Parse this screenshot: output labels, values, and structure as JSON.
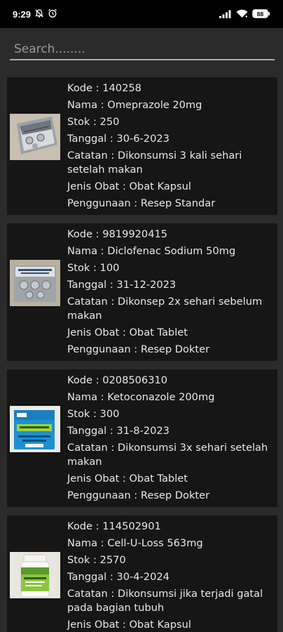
{
  "status": {
    "time": "9:29",
    "battery": "88"
  },
  "search": {
    "placeholder": "Search........"
  },
  "medicines": [
    {
      "kode": "Kode : 140258",
      "nama": "Nama : Omeprazole 20mg",
      "stok": "Stok : 250",
      "tanggal": "Tanggal : 30-6-2023",
      "catatan": "Catatan : Dikonsumsi 3 kali sehari setelah makan",
      "jenis": "Jenis Obat : Obat Kapsul",
      "penggunaan": "Penggunaan : Resep Standar",
      "image": "omeprazole-blister-pack"
    },
    {
      "kode": "Kode : 9819920415",
      "nama": "Nama : Diclofenac Sodium 50mg",
      "stok": "Stok : 100",
      "tanggal": "Tanggal : 31-12-2023",
      "catatan": "Catatan : Dikonsep 2x sehari sebelum makan",
      "jenis": "Jenis Obat : Obat Tablet",
      "penggunaan": "Penggunaan : Resep Dokter",
      "image": "diclofenac-blister-pack"
    },
    {
      "kode": "Kode : 0208506310",
      "nama": "Nama : Ketoconazole 200mg",
      "stok": "Stok : 300",
      "tanggal": "Tanggal : 31-8-2023",
      "catatan": "Catatan : Dikonsumsi 3x sehari setelah makan",
      "jenis": "Jenis Obat : Obat Tablet",
      "penggunaan": "Penggunaan : Resep Dokter",
      "image": "ketoconazole-box"
    },
    {
      "kode": "Kode : 114502901",
      "nama": "Nama : Cell-U-Loss 563mg",
      "stok": "Stok : 2570",
      "tanggal": "Tanggal : 30-4-2024",
      "catatan": "Catatan : Dikonsumsi jika terjadi gatal pada bagian tubuh",
      "jenis": "Jenis Obat : Obat Kapsul",
      "penggunaan": "",
      "image": "cell-u-loss-bottle"
    }
  ]
}
